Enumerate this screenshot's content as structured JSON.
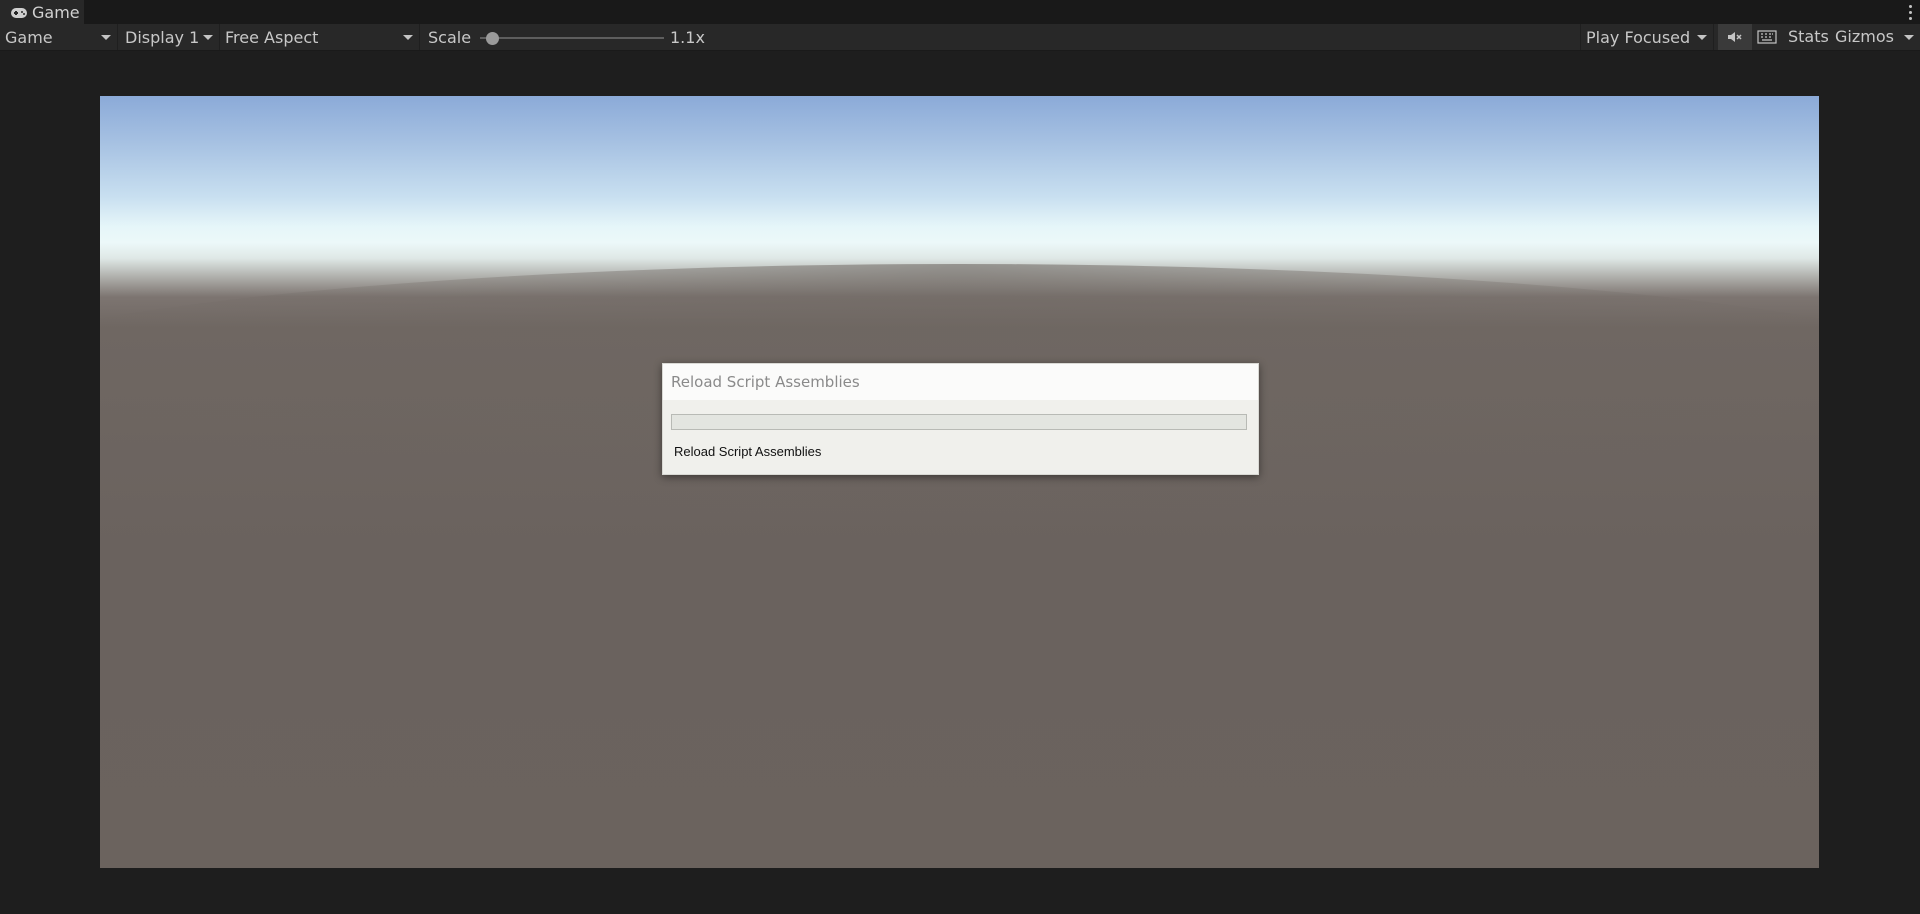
{
  "tab": {
    "title": "Game",
    "icon": "gamepad-icon"
  },
  "toolbar": {
    "view_mode": "Game",
    "display": "Display 1",
    "aspect": "Free Aspect",
    "scale_label": "Scale",
    "scale_value": "1.1x",
    "play_mode": "Play Focused",
    "stats_label": "Stats",
    "gizmos_label": "Gizmos"
  },
  "dialog": {
    "title": "Reload Script Assemblies",
    "message": "Reload Script Assemblies",
    "progress": 0.0
  },
  "colors": {
    "sky_top": "#8baad8",
    "horizon": "#ecf8f9",
    "ground": "#6b635e"
  }
}
